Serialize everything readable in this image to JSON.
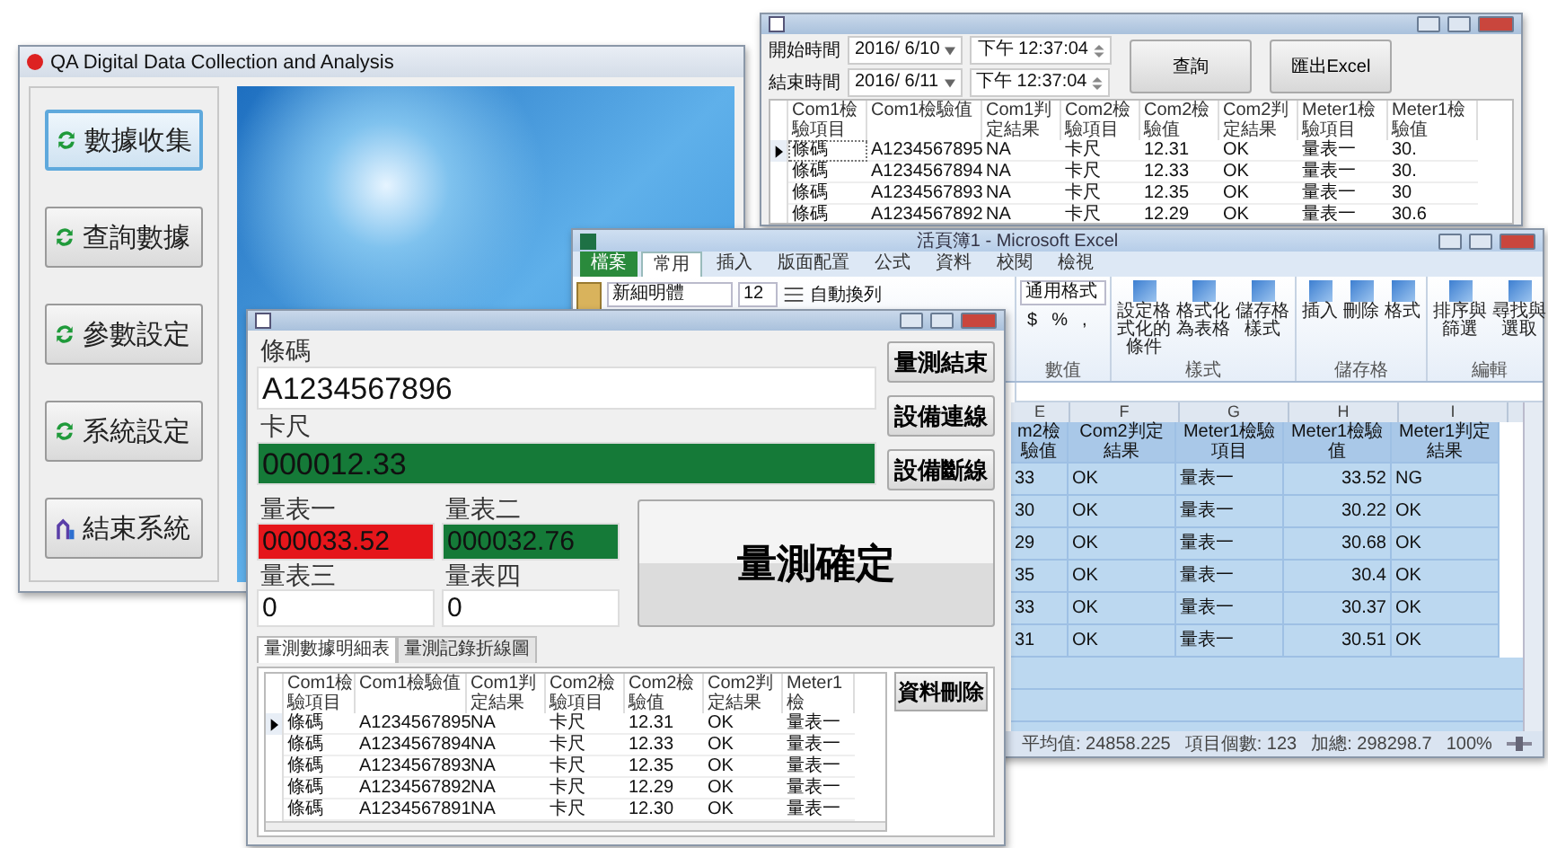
{
  "main_window": {
    "title": "QA Digital Data Collection and Analysis",
    "buttons": [
      {
        "label": "數據收集",
        "kind": "refresh",
        "selected": true
      },
      {
        "label": "查詢數據",
        "kind": "refresh",
        "selected": false
      },
      {
        "label": "參數設定",
        "kind": "refresh",
        "selected": false
      },
      {
        "label": "系統設定",
        "kind": "refresh",
        "selected": false
      },
      {
        "label": "結束系統",
        "kind": "exit",
        "selected": false
      }
    ]
  },
  "query_window": {
    "ranges": [
      {
        "label": "開始時間",
        "date": "2016/ 6/10",
        "time": "下午 12:37:04"
      },
      {
        "label": "結束時間",
        "date": "2016/ 6/11",
        "time": "下午 12:37:04"
      }
    ],
    "buttons": [
      "查詢",
      "匯出Excel"
    ],
    "table": {
      "columns": [
        "Com1檢驗項目",
        "Com1檢驗值",
        "Com1判定結果",
        "Com2檢驗項目",
        "Com2檢驗值",
        "Com2判定結果",
        "Meter1檢驗項目",
        "Meter1檢驗值"
      ],
      "rows": [
        {
          "current": true,
          "cells": [
            "條碼",
            "A1234567895",
            "NA",
            "卡尺",
            "12.31",
            "OK",
            "量表一",
            "30."
          ]
        },
        {
          "current": false,
          "cells": [
            "條碼",
            "A1234567894",
            "NA",
            "卡尺",
            "12.33",
            "OK",
            "量表一",
            "30."
          ]
        },
        {
          "current": false,
          "cells": [
            "條碼",
            "A1234567893",
            "NA",
            "卡尺",
            "12.35",
            "OK",
            "量表一",
            "30"
          ]
        },
        {
          "current": false,
          "cells": [
            "條碼",
            "A1234567892",
            "NA",
            "卡尺",
            "12.29",
            "OK",
            "量表一",
            "30.6"
          ]
        }
      ]
    }
  },
  "excel_window": {
    "title": "活頁簿1 - Microsoft Excel",
    "ribbon_tabs": [
      {
        "label": "檔案",
        "kind": "file",
        "selected": false
      },
      {
        "label": "常用",
        "kind": "tab",
        "selected": true
      },
      {
        "label": "插入",
        "kind": "tab",
        "selected": false
      },
      {
        "label": "版面配置",
        "kind": "tab",
        "selected": false
      },
      {
        "label": "公式",
        "kind": "tab",
        "selected": false
      },
      {
        "label": "資料",
        "kind": "tab",
        "selected": false
      },
      {
        "label": "校閱",
        "kind": "tab",
        "selected": false
      },
      {
        "label": "檢視",
        "kind": "tab",
        "selected": false
      }
    ],
    "font": "新細明體",
    "font_size": "12",
    "wrap_text": "自動換列",
    "number_format": "通用格式",
    "number_symbols": [
      "$",
      "%",
      ","
    ],
    "ribbon_groups": [
      {
        "label": "數值"
      },
      {
        "label": "樣式",
        "buttons": [
          "設定格式化的條件",
          "格式化為表格",
          "儲存格樣式"
        ]
      },
      {
        "label": "儲存格",
        "buttons": [
          "插入",
          "刪除",
          "格式"
        ]
      },
      {
        "label": "編輯",
        "buttons": [
          "排序與篩選",
          "尋找與選取"
        ]
      }
    ],
    "sheet": {
      "columns": [
        {
          "letter": "E",
          "name": "m2檢驗值"
        },
        {
          "letter": "F",
          "name": "Com2判定結果"
        },
        {
          "letter": "G",
          "name": "Meter1檢驗項目"
        },
        {
          "letter": "H",
          "name": "Meter1檢驗值"
        },
        {
          "letter": "I",
          "name": "Meter1判定結果"
        }
      ],
      "rows": [
        [
          "33",
          "OK",
          "量表一",
          "33.52",
          "NG"
        ],
        [
          "30",
          "OK",
          "量表一",
          "30.22",
          "OK"
        ],
        [
          "29",
          "OK",
          "量表一",
          "30.68",
          "OK"
        ],
        [
          "35",
          "OK",
          "量表一",
          "30.4",
          "OK"
        ],
        [
          "33",
          "OK",
          "量表一",
          "30.37",
          "OK"
        ],
        [
          "31",
          "OK",
          "量表一",
          "30.51",
          "OK"
        ]
      ]
    },
    "status_bar": [
      "平均值: 24858.225",
      "項目個數: 123",
      "加總: 298298.7"
    ],
    "zoom": "100%",
    "zoom_slider": {
      "level": 0.5
    }
  },
  "front_window": {
    "fields": [
      {
        "label": "條碼",
        "value": "A1234567896",
        "color": "#ffffff"
      },
      {
        "label": "卡尺",
        "value": "000012.33",
        "color": "#157a38"
      },
      {
        "label": "量表一",
        "value": "000033.52",
        "color": "#e5161b"
      },
      {
        "label": "量表二",
        "value": "000032.76",
        "color": "#157a38"
      },
      {
        "label": "量表三",
        "value": "0",
        "color": "#ffffff"
      },
      {
        "label": "量表四",
        "value": "0",
        "color": "#ffffff"
      }
    ],
    "side_buttons": [
      "量測結束",
      "設備連線",
      "設備斷線"
    ],
    "confirm_button": "量測確定",
    "tabs": [
      {
        "label": "量測數據明細表",
        "selected": true
      },
      {
        "label": "量測記錄折線圖",
        "selected": false
      }
    ],
    "table": {
      "columns": [
        "Com1檢驗項目",
        "Com1檢驗值",
        "Com1判定結果",
        "Com2檢驗項目",
        "Com2檢驗值",
        "Com2判定結果",
        "Meter1檢"
      ],
      "rows": [
        {
          "current": true,
          "cells": [
            "條碼",
            "A1234567895",
            "NA",
            "卡尺",
            "12.31",
            "OK",
            "量表一"
          ]
        },
        {
          "current": false,
          "cells": [
            "條碼",
            "A1234567894",
            "NA",
            "卡尺",
            "12.33",
            "OK",
            "量表一"
          ]
        },
        {
          "current": false,
          "cells": [
            "條碼",
            "A1234567893",
            "NA",
            "卡尺",
            "12.35",
            "OK",
            "量表一"
          ]
        },
        {
          "current": false,
          "cells": [
            "條碼",
            "A1234567892",
            "NA",
            "卡尺",
            "12.29",
            "OK",
            "量表一"
          ]
        },
        {
          "current": false,
          "cells": [
            "條碼",
            "A1234567891",
            "NA",
            "卡尺",
            "12.30",
            "OK",
            "量表一"
          ]
        }
      ]
    },
    "delete_button": "資料刪除"
  }
}
